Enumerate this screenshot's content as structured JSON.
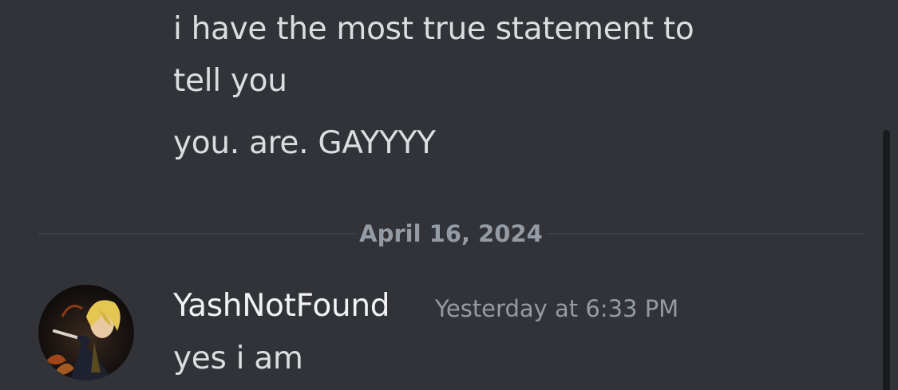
{
  "messages_above": [
    {
      "text": "i have the most true statement to"
    },
    {
      "text": "tell you"
    },
    {
      "text": "you. are. GAYYYY"
    }
  ],
  "date_divider": {
    "label": "April 16, 2024"
  },
  "new_message": {
    "author": "YashNotFound",
    "timestamp": "Yesterday at 6:33 PM",
    "text": "yes i am",
    "avatar_icon": "anime-character-avatar"
  },
  "colors": {
    "background": "#313338",
    "message_text": "#dbdee1",
    "muted_text": "#949ba4",
    "username": "#f2f3f5"
  }
}
